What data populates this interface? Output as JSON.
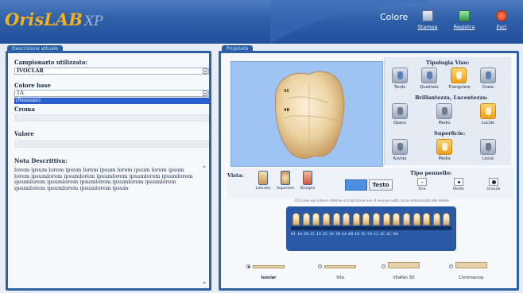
{
  "app": {
    "logo_main": "OrisLAB",
    "logo_suffix": "XP",
    "window_title": "Colore"
  },
  "toolbar": {
    "stampa_label": "Stampa",
    "registra_label": "Registra",
    "esci_label": "Esci"
  },
  "left_panel": {
    "tab_label": "Descrizione attuale",
    "campionario_label": "Campionario utilizzato:",
    "campionario_value": "IVOCLAR",
    "colore_base_label": "Colore base",
    "colore_base_value": "1A",
    "dropdown_option": "(Nessuno)",
    "croma_label": "Croma",
    "valore_label": "Valore",
    "nota_label": "Nota Descrittiva:",
    "nota_text": "lorem ipsum lorem ipsum lorem ipsum lorem ipsum lorem ipsum lorem ipsumlorem ipsumlorem ipsumlorem ipsumlorem ipsumlorem ipsumlorem ipsumlorem ipsumlorem ipsumlorem ipsumlorem ipsumlorem ipsumlorem ipsumlorem ipsum"
  },
  "right_panel": {
    "tab_label": "Proprietà",
    "tooth_labels": [
      "3C",
      "4B"
    ],
    "tipologia": {
      "title": "Tipologia Viso:",
      "options": [
        "Tondo",
        "Quadrato",
        "Triangolare",
        "Ovale"
      ],
      "selected": "Triangolare"
    },
    "brillantezza": {
      "title": "Brillantezza, Lucentezza:",
      "options": [
        "Opaco",
        "Medio",
        "Lucido"
      ],
      "selected": "Lucido"
    },
    "superficie": {
      "title": "Superficie:",
      "options": [
        "Ruvida",
        "Media",
        "Liscia"
      ],
      "selected": "Media"
    },
    "vista": {
      "title": "Vista:",
      "options": [
        "Laterale",
        "Superiore",
        "Disegno"
      ]
    },
    "testo_button": "Testo",
    "tipo_pennello": {
      "title": "Tipo pennello:",
      "options": [
        "Fine",
        "Medio",
        "Grande"
      ]
    },
    "hint": "Cliccare sul colore interno e trascinare con il mouse sulla zona interessata del dente",
    "shade_guide_labels": "B1  1A  2B  1C  1A  2C  3A  3B  4A  4B  4D  3C  5A  1C  4C  4C  4D",
    "shade_tabs_count": 16,
    "shade_guides": {
      "options": [
        "Ivoclar",
        "Vita",
        "VitaPan 3D",
        "Chromascop"
      ],
      "selected": "Ivoclar"
    }
  },
  "colors": {
    "titlebar": "#2f5fa8",
    "panel_border": "#2c60a7",
    "selected_option": "#f0a020",
    "logo_accent": "#f2b21c"
  }
}
